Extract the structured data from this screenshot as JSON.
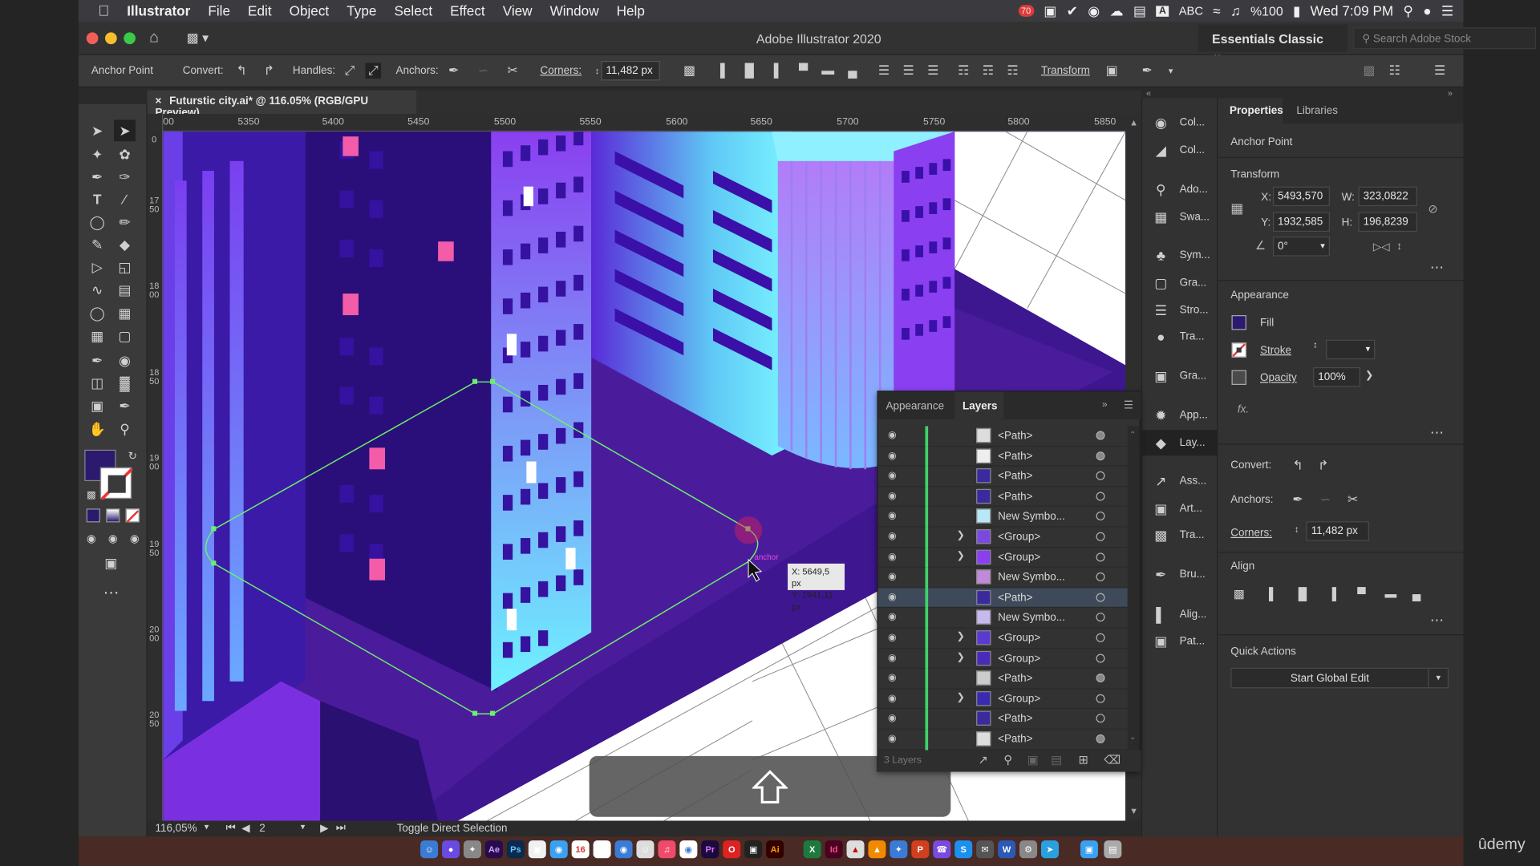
{
  "menubar": {
    "apple": "",
    "app": "Illustrator",
    "items": [
      "File",
      "Edit",
      "Object",
      "Type",
      "Select",
      "Effect",
      "View",
      "Window",
      "Help"
    ],
    "input_source": "ABC",
    "battery": "%100",
    "clock": "Wed 7:09 PM",
    "notification_badge": "70"
  },
  "titlebar": {
    "title": "Adobe Illustrator 2020",
    "workspace": "Essentials Classic",
    "stock_placeholder": "Search Adobe Stock"
  },
  "controlbar": {
    "tool_name": "Anchor Point",
    "convert": "Convert:",
    "handles": "Handles:",
    "anchors": "Anchors:",
    "corners": "Corners:",
    "corner_value": "11,482 px",
    "transform": "Transform"
  },
  "document": {
    "tab_title": "Futurstic city.ai* @ 116.05% (RGB/GPU Preview)"
  },
  "ruler": {
    "top": [
      "00",
      "5350",
      "5400",
      "5450",
      "5500",
      "5550",
      "5600",
      "5650",
      "5700",
      "5750",
      "5800",
      "5850"
    ],
    "left": [
      "0",
      "1750",
      "1800",
      "1850",
      "1900",
      "1950",
      "2000",
      "2050"
    ]
  },
  "canvas": {
    "tooltip_x": "X: 5649,5 px",
    "tooltip_y": "Y: 1941,11 px",
    "anchor_hint": "anchor"
  },
  "statusbar": {
    "zoom": "116,05%",
    "artboard": "2",
    "message": "Toggle Direct Selection"
  },
  "midcol": {
    "items": [
      "Col...",
      "Col...",
      "Ado...",
      "Swa...",
      "Sym...",
      "Gra...",
      "Stro...",
      "Tra...",
      "Gra...",
      "App...",
      "Lay...",
      "Ass...",
      "Art...",
      "Tra...",
      "Bru...",
      "Alig...",
      "Pat..."
    ]
  },
  "layers": {
    "tabs": [
      "Appearance",
      "Layers"
    ],
    "rows": [
      {
        "name": "<Path>",
        "arrow": false
      },
      {
        "name": "<Path>",
        "arrow": false
      },
      {
        "name": "<Path>",
        "arrow": false
      },
      {
        "name": "<Path>",
        "arrow": false
      },
      {
        "name": "New Symbo...",
        "arrow": false
      },
      {
        "name": "<Group>",
        "arrow": true
      },
      {
        "name": "<Group>",
        "arrow": true
      },
      {
        "name": "New Symbo...",
        "arrow": false
      },
      {
        "name": "<Path>",
        "arrow": false
      },
      {
        "name": "New Symbo...",
        "arrow": false
      },
      {
        "name": "<Group>",
        "arrow": true
      },
      {
        "name": "<Group>",
        "arrow": true
      },
      {
        "name": "<Path>",
        "arrow": false
      },
      {
        "name": "<Group>",
        "arrow": true
      },
      {
        "name": "<Path>",
        "arrow": false
      },
      {
        "name": "<Path>",
        "arrow": false
      }
    ],
    "selected_row": 8,
    "footer": "3 Layers"
  },
  "properties": {
    "tabs": [
      "Properties",
      "Libraries"
    ],
    "selection": "Anchor Point",
    "transform_title": "Transform",
    "x_label": "X:",
    "x": "5493,570",
    "y_label": "Y:",
    "y": "1932,585",
    "w_label": "W:",
    "w": "323,0822",
    "h_label": "H:",
    "h": "196,8239",
    "angle": "0°",
    "appearance_title": "Appearance",
    "fill": "Fill",
    "stroke": "Stroke",
    "opacity": "Opacity",
    "opacity_value": "100%",
    "fx": "fx.",
    "convert": "Convert:",
    "anchors": "Anchors:",
    "corners": "Corners:",
    "corner_value": "11,482 px",
    "align_title": "Align",
    "quick_actions_title": "Quick Actions",
    "global_edit": "Start Global Edit"
  },
  "watermark": "ûdemy",
  "colors": {
    "fill_swatch": "#2b1a6e",
    "canvas_bg": "#4a1c9c",
    "selection": "#6cf06c",
    "layer_bar": "#3fd36b"
  }
}
